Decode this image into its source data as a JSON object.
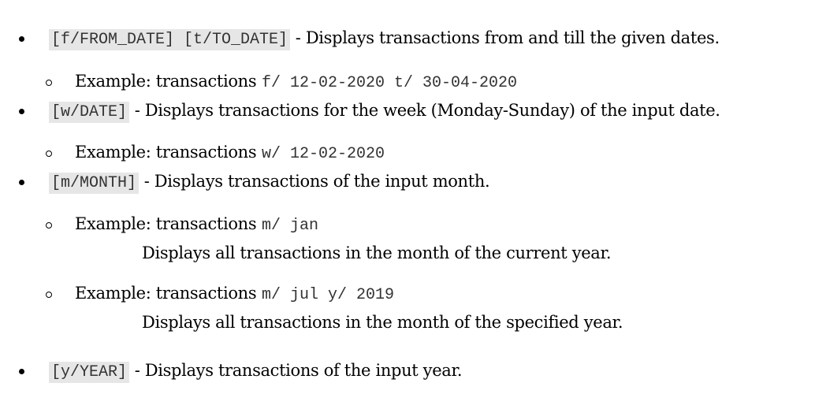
{
  "items": [
    {
      "code": "[f/FROM_DATE] [t/TO_DATE]",
      "text": "- Displays transactions from and till the given dates.",
      "examples": [
        {
          "label": "Example: transactions",
          "code": "f/ 12-02-2020 t/ 30-04-2020"
        }
      ]
    },
    {
      "code": "[w/DATE]",
      "text": "- Displays transactions for the week (Monday-Sunday) of the input date.",
      "examples": [
        {
          "label": "Example: transactions",
          "code": "w/ 12-02-2020"
        }
      ]
    },
    {
      "code": "[m/MONTH]",
      "text": "- Displays transactions of the input month.",
      "examples": [
        {
          "label": "Example: transactions",
          "code": "m/ jan",
          "note": "Displays all transactions in the month of the current year."
        },
        {
          "label": "Example: transactions",
          "code": "m/ jul y/ 2019",
          "note": "Displays all transactions in the month of the specified year."
        }
      ]
    },
    {
      "code": "[y/YEAR]",
      "text": "- Displays transactions of the input year."
    }
  ]
}
